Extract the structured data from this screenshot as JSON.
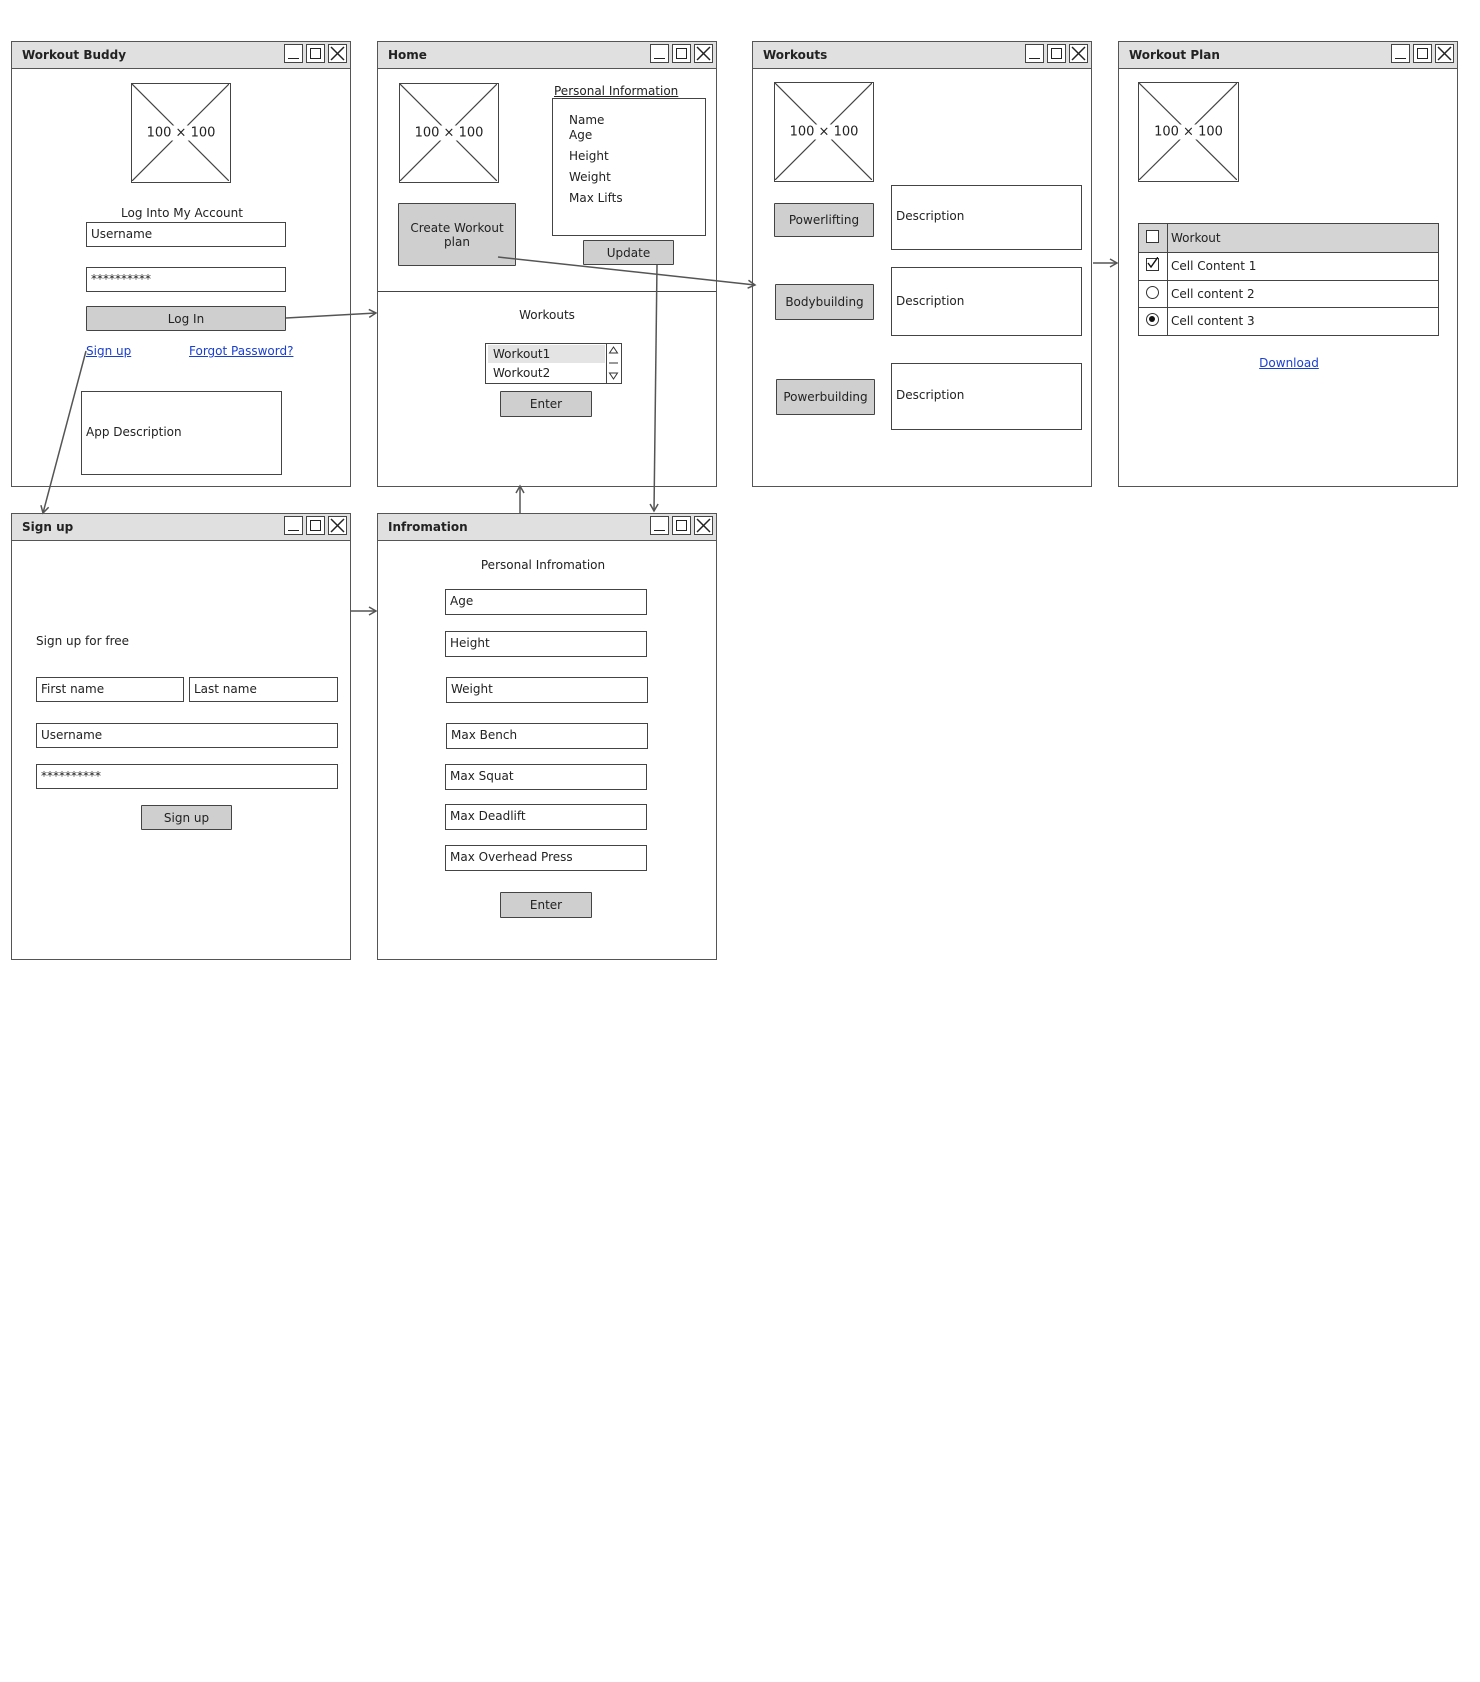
{
  "windows": {
    "login": {
      "title": "Workout Buddy",
      "image_label": "100 × 100",
      "heading": "Log Into My Account",
      "username": "Username",
      "password": "**********",
      "login_button": "Log In",
      "signup_link": "Sign up",
      "forgot_link": "Forgot Password?",
      "app_description": "App Description"
    },
    "home": {
      "title": "Home",
      "image_label": "100 × 100",
      "create_button": "Create Workout plan",
      "personal_info_label": "Personal Information",
      "personal_fields": [
        "Name",
        "Age",
        "Height",
        "Weight",
        "Max Lifts"
      ],
      "update_button": "Update",
      "workouts_label": "Workouts",
      "workout_list": [
        "Workout1",
        "Workout2"
      ],
      "enter_button": "Enter"
    },
    "workouts": {
      "title": "Workouts",
      "image_label": "100 × 100",
      "items": [
        {
          "button": "Powerlifting",
          "description": "Description"
        },
        {
          "button": "Bodybuilding",
          "description": "Description"
        },
        {
          "button": "Powerbuilding",
          "description": "Description"
        }
      ]
    },
    "plan": {
      "title": "Workout Plan",
      "image_label": "100 × 100",
      "table_header": "Workout",
      "rows": [
        {
          "text": "Cell Content 1",
          "mark": "checked-checkbox"
        },
        {
          "text": "Cell content 2",
          "mark": "empty-radio"
        },
        {
          "text": "Cell content 3",
          "mark": "selected-radio"
        }
      ],
      "download_link": "Download"
    },
    "signup": {
      "title": "Sign up",
      "heading": "Sign up for free",
      "first_name": "First name",
      "last_name": "Last name",
      "username": "Username",
      "password": "**********",
      "signup_button": "Sign up"
    },
    "info": {
      "title": "Infromation",
      "heading": "Personal Infromation",
      "fields": [
        "Age",
        "Height",
        "Weight",
        "Max Bench",
        "Max Squat",
        "Max Deadlift",
        "Max Overhead Press"
      ],
      "enter_button": "Enter"
    }
  },
  "colors": {
    "titlebar": "#e0e0e0",
    "button": "#cfcfcf",
    "link": "#1a3fd0",
    "border": "#444444"
  }
}
